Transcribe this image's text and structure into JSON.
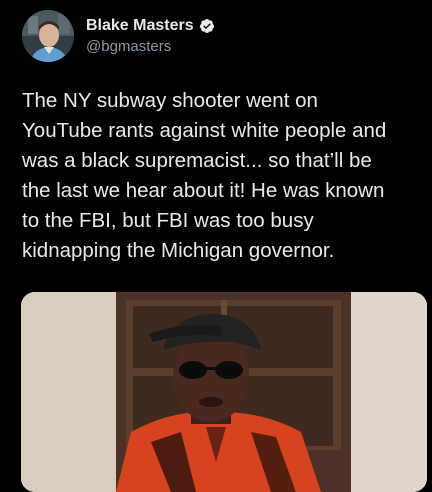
{
  "tweet": {
    "author": {
      "display_name": "Blake Masters",
      "handle": "@bgmasters",
      "verified": true,
      "verified_icon": "verified-badge-icon",
      "verified_color": "#e7e9ea"
    },
    "text_lines": [
      "The NY subway shooter went on",
      "YouTube rants against white people and",
      "was a black supremacist... so that’ll be",
      "the last we hear about it! He was known",
      "to the FBI, but FBI was too busy",
      "kidnapping the Michigan governor."
    ],
    "media": {
      "type": "video-still"
    }
  },
  "colors": {
    "background": "#000000",
    "text_primary": "#e7e9ea",
    "text_secondary": "#8b98a5"
  }
}
